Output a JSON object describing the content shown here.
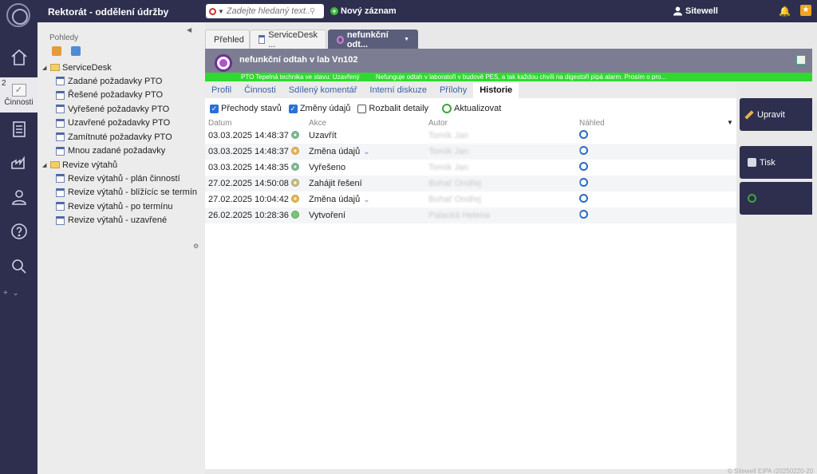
{
  "app": {
    "title": "Rektorát - oddělení údržby"
  },
  "search": {
    "placeholder": "Zadejte hledaný text..."
  },
  "toolbar": {
    "new_record_label": "Nový záznam"
  },
  "user": {
    "name": "Sitewell"
  },
  "rail": {
    "activities_label": "Činnosti",
    "activities_count": "2"
  },
  "views": {
    "title": "Pohledy",
    "folders": [
      {
        "label": "ServiceDesk",
        "items": [
          "Zadané požadavky PTO",
          "Řešené požadavky PTO",
          "Vyřešené požadavky PTO",
          "Uzavřené požadavky PTO",
          "Zamítnuté požadavky PTO",
          "Mnou zadané požadavky"
        ]
      },
      {
        "label": "Revize výtahů",
        "items": [
          "Revize výtahů - plán činností",
          "Revize výtahů - blížícíc se termín",
          "Revize výtahů - po termínu",
          "Revize výtahů - uzavřené"
        ]
      }
    ]
  },
  "tabs": {
    "overview": "Přehled",
    "servicedesk": "ServiceDesk ...",
    "record": "nefunkční odt..."
  },
  "record": {
    "title": "nefunkční odtah v lab Vn102",
    "status_line": "PTO Tepelná technika ve stavu: Uzavřený",
    "description_line": "Nefunguje odtah v laboratoři v budově PES, a tak každou chvíli na digestoři pípá alarm. Prosím o pro..."
  },
  "subtabs": [
    "Profil",
    "Činnosti",
    "Sdílený komentář",
    "Interní diskuze",
    "Přílohy",
    "Historie"
  ],
  "subtab_active": 5,
  "history": {
    "options": {
      "state_transitions": "Přechody stavů",
      "data_changes": "Změny údajů",
      "expand_details": "Rozbalit detaily",
      "refresh": "Aktualizovat"
    },
    "columns": {
      "date": "Datum",
      "action": "Akce",
      "author": "Autor",
      "preview": "Náhled"
    },
    "rows": [
      {
        "date": "03.03.2025 14:48:37",
        "action": "Uzavřít",
        "author": "Tomík Jan",
        "icon": "st-close",
        "chevron": ""
      },
      {
        "date": "03.03.2025 14:48:37",
        "action": "Změna údajů",
        "author": "Tomík Jan",
        "icon": "st-edit",
        "chevron": "⌄"
      },
      {
        "date": "03.03.2025 14:48:35",
        "action": "Vyřešeno",
        "author": "Tomík Jan",
        "icon": "st-resolved",
        "chevron": ""
      },
      {
        "date": "27.02.2025 14:50:08",
        "action": "Zahájit řešení",
        "author": "Bohať Ondřej",
        "icon": "st-start",
        "chevron": ""
      },
      {
        "date": "27.02.2025 10:04:42",
        "action": "Změna údajů",
        "author": "Bohať Ondřej",
        "icon": "st-edit",
        "chevron": "⌄"
      },
      {
        "date": "26.02.2025 10:28:36",
        "action": "Vytvoření",
        "author": "Palacká Helena",
        "icon": "st-created",
        "chevron": ""
      }
    ]
  },
  "actions": {
    "edit": "Upravit",
    "print": "Tisk"
  },
  "footer": "© Sitewell EIPA r20250220-20"
}
